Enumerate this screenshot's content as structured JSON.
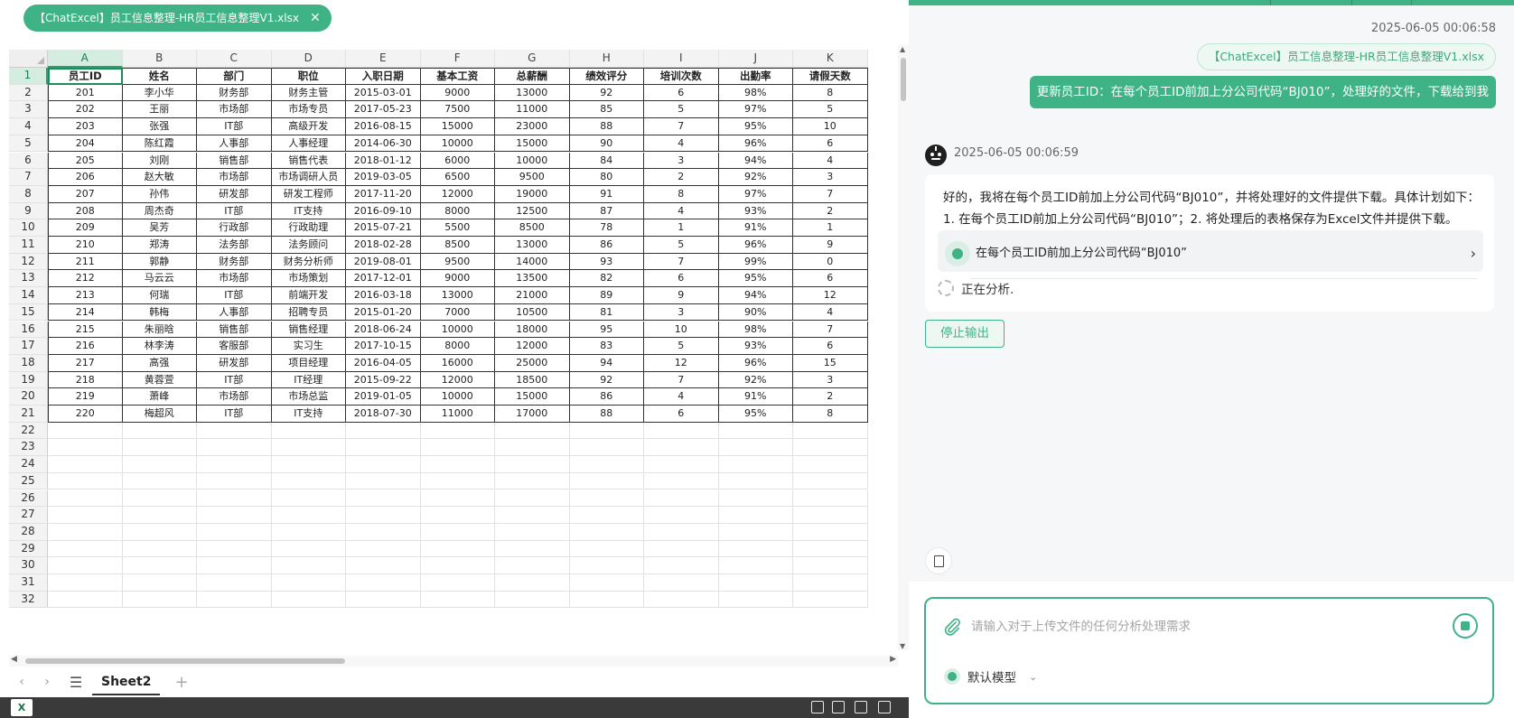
{
  "spreadsheet": {
    "file_tab": "【ChatExcel】员工信息整理-HR员工信息整理V1.xlsx",
    "close_glyph": "✕",
    "columns": [
      "A",
      "B",
      "C",
      "D",
      "E",
      "F",
      "G",
      "H",
      "I",
      "J",
      "K"
    ],
    "selected_column": "A",
    "selected_row": 1,
    "headers": [
      "员工ID",
      "姓名",
      "部门",
      "职位",
      "入职日期",
      "基本工资",
      "总薪酬",
      "绩效评分",
      "培训次数",
      "出勤率",
      "请假天数"
    ],
    "rows": [
      [
        "201",
        "李小华",
        "财务部",
        "财务主管",
        "2015-03-01",
        "9000",
        "13000",
        "92",
        "6",
        "98%",
        "8"
      ],
      [
        "202",
        "王丽",
        "市场部",
        "市场专员",
        "2017-05-23",
        "7500",
        "11000",
        "85",
        "5",
        "97%",
        "5"
      ],
      [
        "203",
        "张强",
        "IT部",
        "高级开发",
        "2016-08-15",
        "15000",
        "23000",
        "88",
        "7",
        "95%",
        "10"
      ],
      [
        "204",
        "陈红霞",
        "人事部",
        "人事经理",
        "2014-06-30",
        "10000",
        "15000",
        "90",
        "4",
        "96%",
        "6"
      ],
      [
        "205",
        "刘刚",
        "销售部",
        "销售代表",
        "2018-01-12",
        "6000",
        "10000",
        "84",
        "3",
        "94%",
        "4"
      ],
      [
        "206",
        "赵大敏",
        "市场部",
        "市场调研人员",
        "2019-03-05",
        "6500",
        "9500",
        "80",
        "2",
        "92%",
        "3"
      ],
      [
        "207",
        "孙伟",
        "研发部",
        "研发工程师",
        "2017-11-20",
        "12000",
        "19000",
        "91",
        "8",
        "97%",
        "7"
      ],
      [
        "208",
        "周杰奇",
        "IT部",
        "IT支持",
        "2016-09-10",
        "8000",
        "12500",
        "87",
        "4",
        "93%",
        "2"
      ],
      [
        "209",
        "吴芳",
        "行政部",
        "行政助理",
        "2015-07-21",
        "5500",
        "8500",
        "78",
        "1",
        "91%",
        "1"
      ],
      [
        "210",
        "郑涛",
        "法务部",
        "法务顾问",
        "2018-02-28",
        "8500",
        "13000",
        "86",
        "5",
        "96%",
        "9"
      ],
      [
        "211",
        "郭静",
        "财务部",
        "财务分析师",
        "2019-08-01",
        "9500",
        "14000",
        "93",
        "7",
        "99%",
        "0"
      ],
      [
        "212",
        "马云云",
        "市场部",
        "市场策划",
        "2017-12-01",
        "9000",
        "13500",
        "82",
        "6",
        "95%",
        "6"
      ],
      [
        "213",
        "何瑞",
        "IT部",
        "前端开发",
        "2016-03-18",
        "13000",
        "21000",
        "89",
        "9",
        "94%",
        "12"
      ],
      [
        "214",
        "韩梅",
        "人事部",
        "招聘专员",
        "2015-01-20",
        "7000",
        "10500",
        "81",
        "3",
        "90%",
        "4"
      ],
      [
        "215",
        "朱丽晗",
        "销售部",
        "销售经理",
        "2018-06-24",
        "10000",
        "18000",
        "95",
        "10",
        "98%",
        "7"
      ],
      [
        "216",
        "林李涛",
        "客服部",
        "实习生",
        "2017-10-15",
        "8000",
        "12000",
        "83",
        "5",
        "93%",
        "6"
      ],
      [
        "217",
        "高强",
        "研发部",
        "项目经理",
        "2016-04-05",
        "16000",
        "25000",
        "94",
        "12",
        "96%",
        "15"
      ],
      [
        "218",
        "黄蓉萱",
        "IT部",
        "IT经理",
        "2015-09-22",
        "12000",
        "18500",
        "92",
        "7",
        "92%",
        "3"
      ],
      [
        "219",
        "萧峰",
        "市场部",
        "市场总监",
        "2019-01-05",
        "10000",
        "15000",
        "86",
        "4",
        "91%",
        "2"
      ],
      [
        "220",
        "梅超风",
        "IT部",
        "IT支持",
        "2018-07-30",
        "11000",
        "17000",
        "88",
        "6",
        "95%",
        "8"
      ]
    ],
    "row_numbers": [
      "1",
      "2",
      "3",
      "4",
      "5",
      "6",
      "7",
      "8",
      "9",
      "10",
      "11",
      "12",
      "13",
      "14",
      "15",
      "16",
      "17",
      "18",
      "19",
      "20",
      "21",
      "22",
      "23",
      "24",
      "25",
      "26",
      "27",
      "28",
      "29",
      "30",
      "31",
      "32"
    ],
    "sheet_tab": "Sheet2",
    "add_sheet": "+",
    "menu_glyph": "☰",
    "prev_glyph": "‹",
    "next_glyph": "›",
    "excel_icon_label": "X"
  },
  "chat": {
    "user_timestamp": "2025-06-05 00:06:58",
    "file_chip": "【ChatExcel】员工信息整理-HR员工信息整理V1.xlsx",
    "user_message": "更新员工ID：在每个员工ID前加上分公司代码“BJ010”，处理好的文件，下载给到我",
    "bot_timestamp": "2025-06-05 00:06:59",
    "bot_message": "好的，我将在每个员工ID前加上分公司代码“BJ010”，并将处理好的文件提供下载。具体计划如下：1. 在每个员工ID前加上分公司代码“BJ010”；2. 将处理后的表格保存为Excel文件并提供下载。",
    "step_label": "在每个员工ID前加上分公司代码“BJ010”",
    "step_chevron": "›",
    "analyzing": "正在分析.",
    "stop_button": "停止输出",
    "input_placeholder": "请输入对于上传文件的任何分析处理需求",
    "model_label": "默认模型",
    "model_caret": "⌄",
    "accent": "#3fb385"
  }
}
